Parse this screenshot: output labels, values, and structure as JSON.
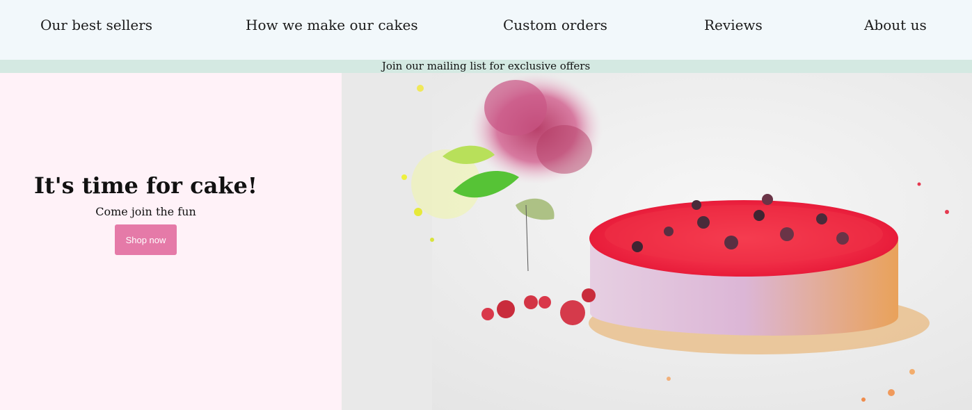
{
  "nav": {
    "items": [
      {
        "label": "Our best sellers"
      },
      {
        "label": "How we make our cakes"
      },
      {
        "label": "Custom orders"
      },
      {
        "label": "Reviews"
      },
      {
        "label": "About us"
      }
    ]
  },
  "banner": {
    "text": "Join our mailing list for exclusive offers"
  },
  "hero": {
    "title": "It's time for cake!",
    "subtitle": "Come join the fun",
    "button_label": "Shop now",
    "button_color": "#e57aa8",
    "image_alt": "Watercolor illustration of a berry cheesecake with flowers"
  },
  "colors": {
    "nav_bg": "#f2f8fb",
    "banner_bg": "#d4e9e2",
    "hero_left_bg": "#fff2f8"
  }
}
